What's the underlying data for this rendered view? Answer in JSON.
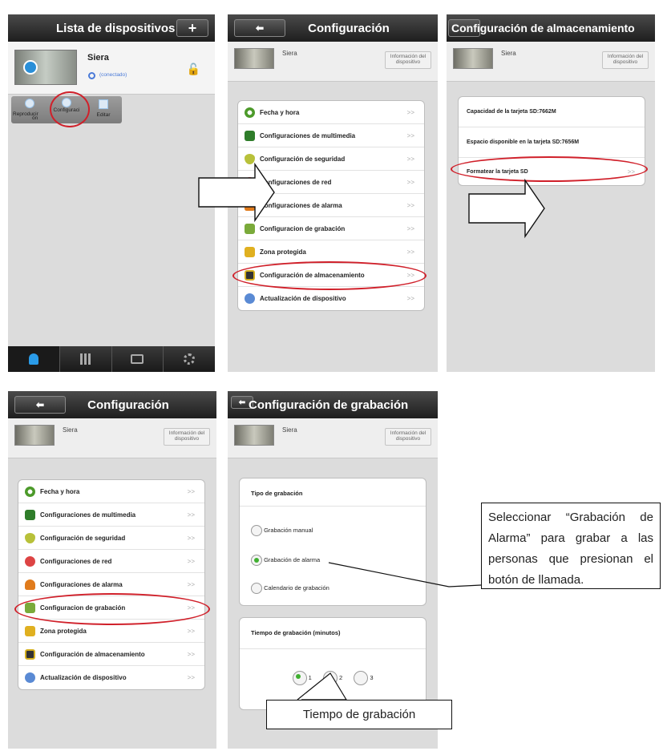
{
  "panel1": {
    "title": "Lista de dispositivos",
    "add_label": "+",
    "device_name": "Siera",
    "device_status": "(conectado)",
    "actions": [
      "Reproducir",
      "Configuración",
      "Editar"
    ],
    "action_button_labels": [
      "Reproducir",
      "Configuraci",
      "ón",
      "Editar"
    ],
    "tabs": [
      "devices",
      "grid",
      "toolbox",
      "settings"
    ]
  },
  "config": {
    "back_label": "⬅",
    "title": "Configuración",
    "device_name": "Siera",
    "info_line1": "Información del",
    "info_line2": "dispositivo",
    "chevron": ">>",
    "items": [
      "Fecha y hora",
      "Configuraciones de multimedia",
      "Configuración de seguridad",
      "Configuraciones de red",
      "Configuraciones de alarma",
      "Configuracion de grabación",
      "Zona protegida",
      "Configuración de almacenamiento",
      "Actualización de dispositivo"
    ]
  },
  "storage": {
    "title": "Configuración de almacenamiento",
    "sd_capacity": "Capacidad de la tarjeta SD:7662M",
    "sd_available": "Espacio disponible en la tarjeta SD:7656M",
    "format_label": "Formatear la tarjeta SD"
  },
  "recording": {
    "title": "Configuración de grabación",
    "type_header": "Tipo de grabación",
    "options": [
      "Grabación manual",
      "Grabación de alarma",
      "Calendario de grabación"
    ],
    "selected_option": 1,
    "time_header": "Tiempo de grabación (minutos)",
    "time_options": [
      "1",
      "2",
      "3"
    ],
    "selected_time": 0
  },
  "annotations": {
    "callout": "Seleccionar “Grabación de Alarma” para grabar a las personas que presionan el botón de llamada.",
    "time_label": "Tiempo de grabación"
  },
  "colors": {
    "highlight": "#d0202a",
    "selected_radio": "#3fb030",
    "header": "#2a2a2a"
  }
}
